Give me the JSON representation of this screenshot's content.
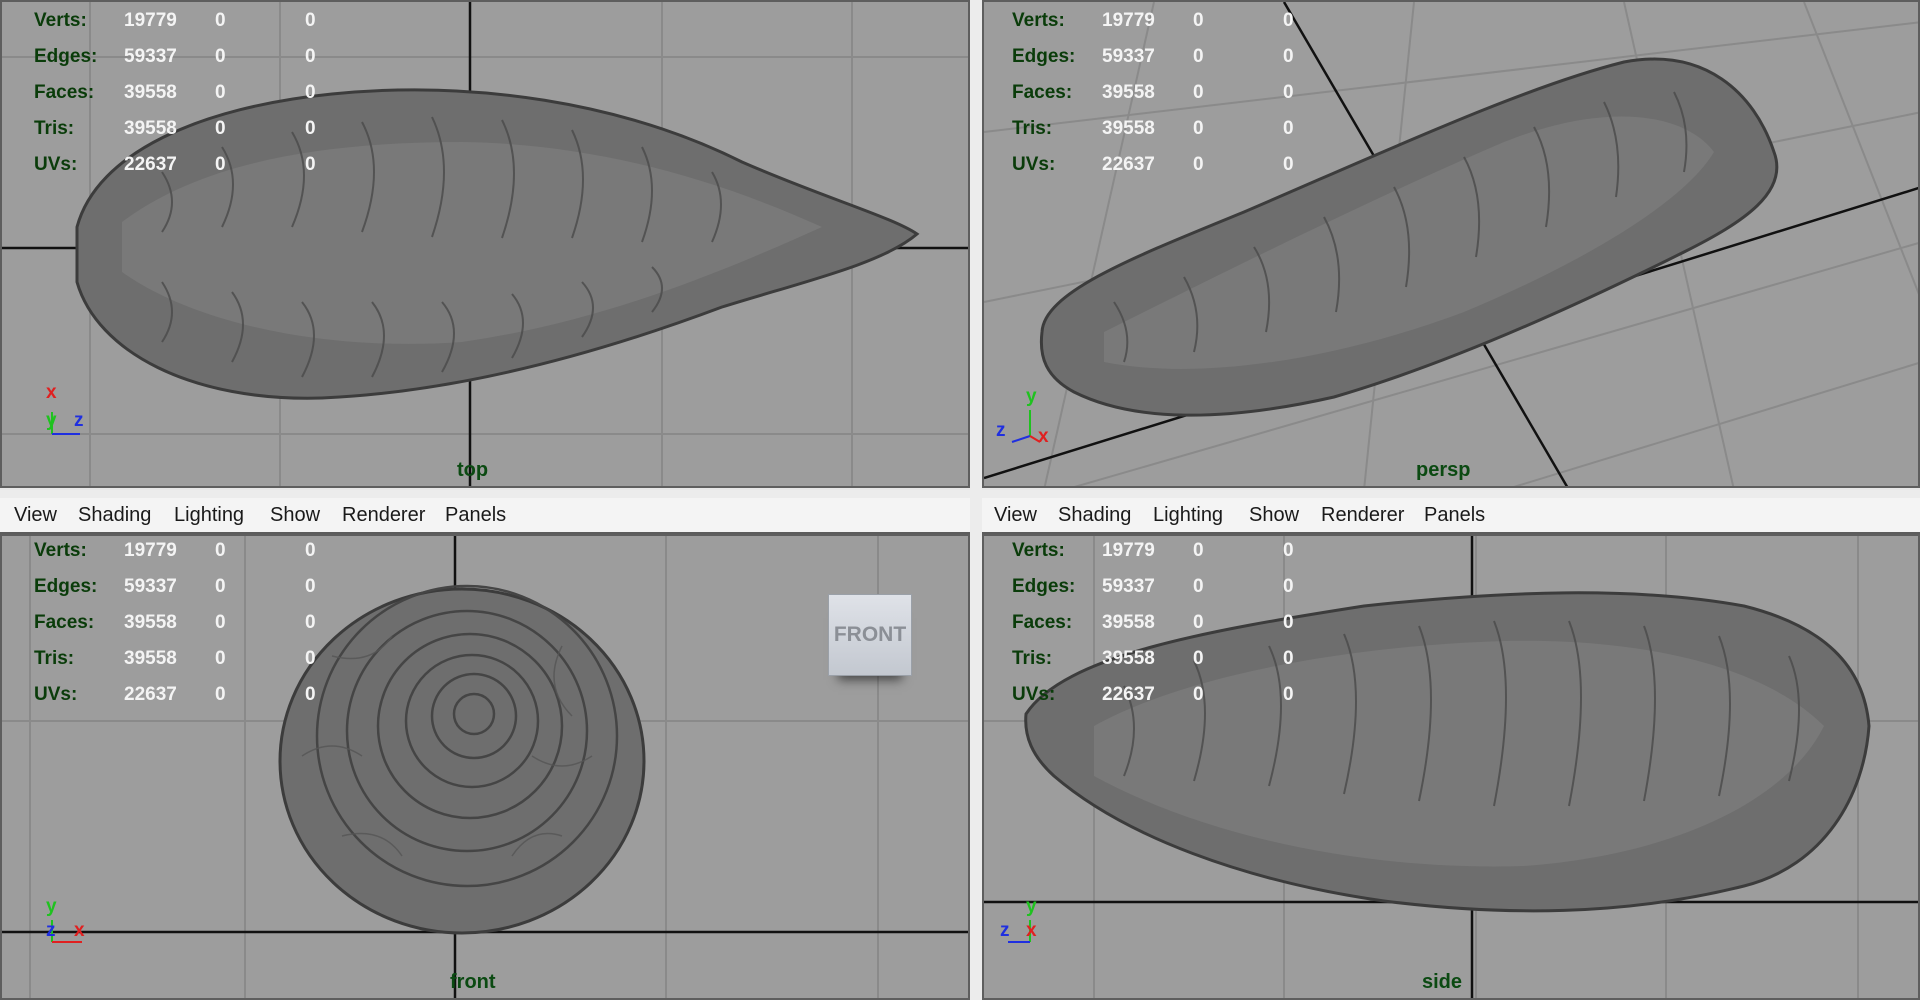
{
  "menu": {
    "view": "View",
    "shading": "Shading",
    "lighting": "Lighting",
    "show": "Show",
    "renderer": "Renderer",
    "panels": "Panels"
  },
  "hud": {
    "labels": [
      "Verts:",
      "Edges:",
      "Faces:",
      "Tris:",
      "UVs:"
    ],
    "values": [
      "19779",
      "59337",
      "39558",
      "39558",
      "22637"
    ],
    "zero": "0"
  },
  "views": {
    "top": "top",
    "persp": "persp",
    "front": "front",
    "side": "side"
  },
  "axes": {
    "x": "x",
    "y": "y",
    "z": "z"
  },
  "viewcube": {
    "front_label": "FRONT"
  },
  "colors": {
    "viewport_bg": "#9d9d9d",
    "hud_label": "#0a3c0a",
    "hud_value": "#f4f4f4",
    "view_name": "#0b4a12",
    "axis_x": "#e02020",
    "axis_y": "#1fc21f",
    "axis_z": "#1f2fe0"
  },
  "icons": [
    "viewcube-icon",
    "axis-gizmo-icon"
  ]
}
